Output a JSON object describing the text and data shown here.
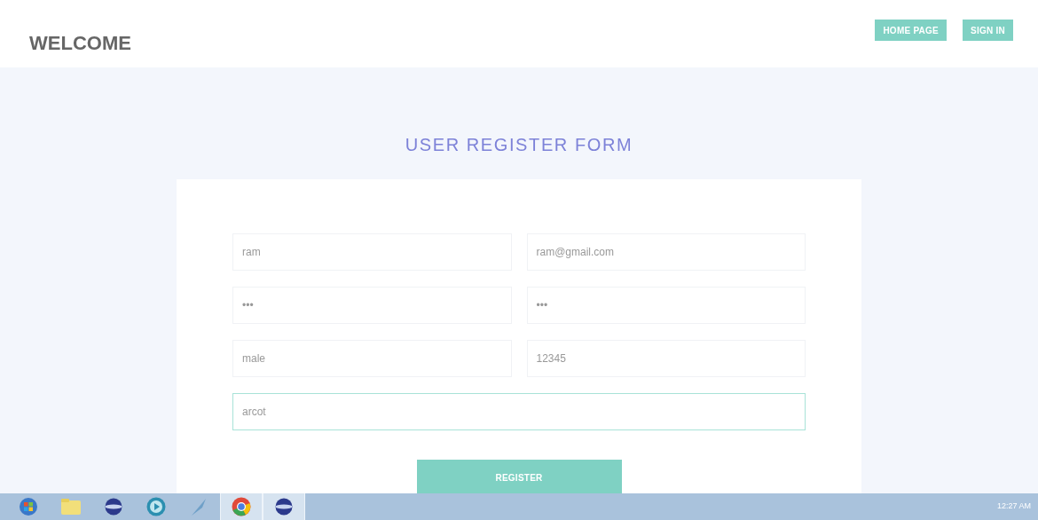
{
  "header": {
    "title": "WELCOME",
    "buttons": [
      "HOME PAGE",
      "SIGN IN"
    ]
  },
  "form": {
    "title": "USER REGISTER FORM",
    "fields": [
      {
        "value": "ram",
        "focused": false,
        "wide": false
      },
      {
        "value": "ram@gmail.com",
        "focused": false,
        "wide": false
      },
      {
        "value": "•••",
        "focused": false,
        "wide": false
      },
      {
        "value": "•••",
        "focused": false,
        "wide": false
      },
      {
        "value": "male",
        "focused": false,
        "wide": false
      },
      {
        "value": "12345",
        "focused": false,
        "wide": false
      },
      {
        "value": "arcot",
        "focused": true,
        "wide": true
      }
    ],
    "submit": "REGISTER"
  },
  "taskbar": {
    "apps": [
      {
        "kind": "start",
        "selected": false
      },
      {
        "kind": "folder",
        "selected": false
      },
      {
        "kind": "globe",
        "selected": false
      },
      {
        "kind": "media",
        "selected": false
      },
      {
        "kind": "tool",
        "selected": false
      },
      {
        "kind": "chrome",
        "selected": true
      },
      {
        "kind": "globe",
        "selected": true
      }
    ],
    "clock": "12:27 AM"
  }
}
